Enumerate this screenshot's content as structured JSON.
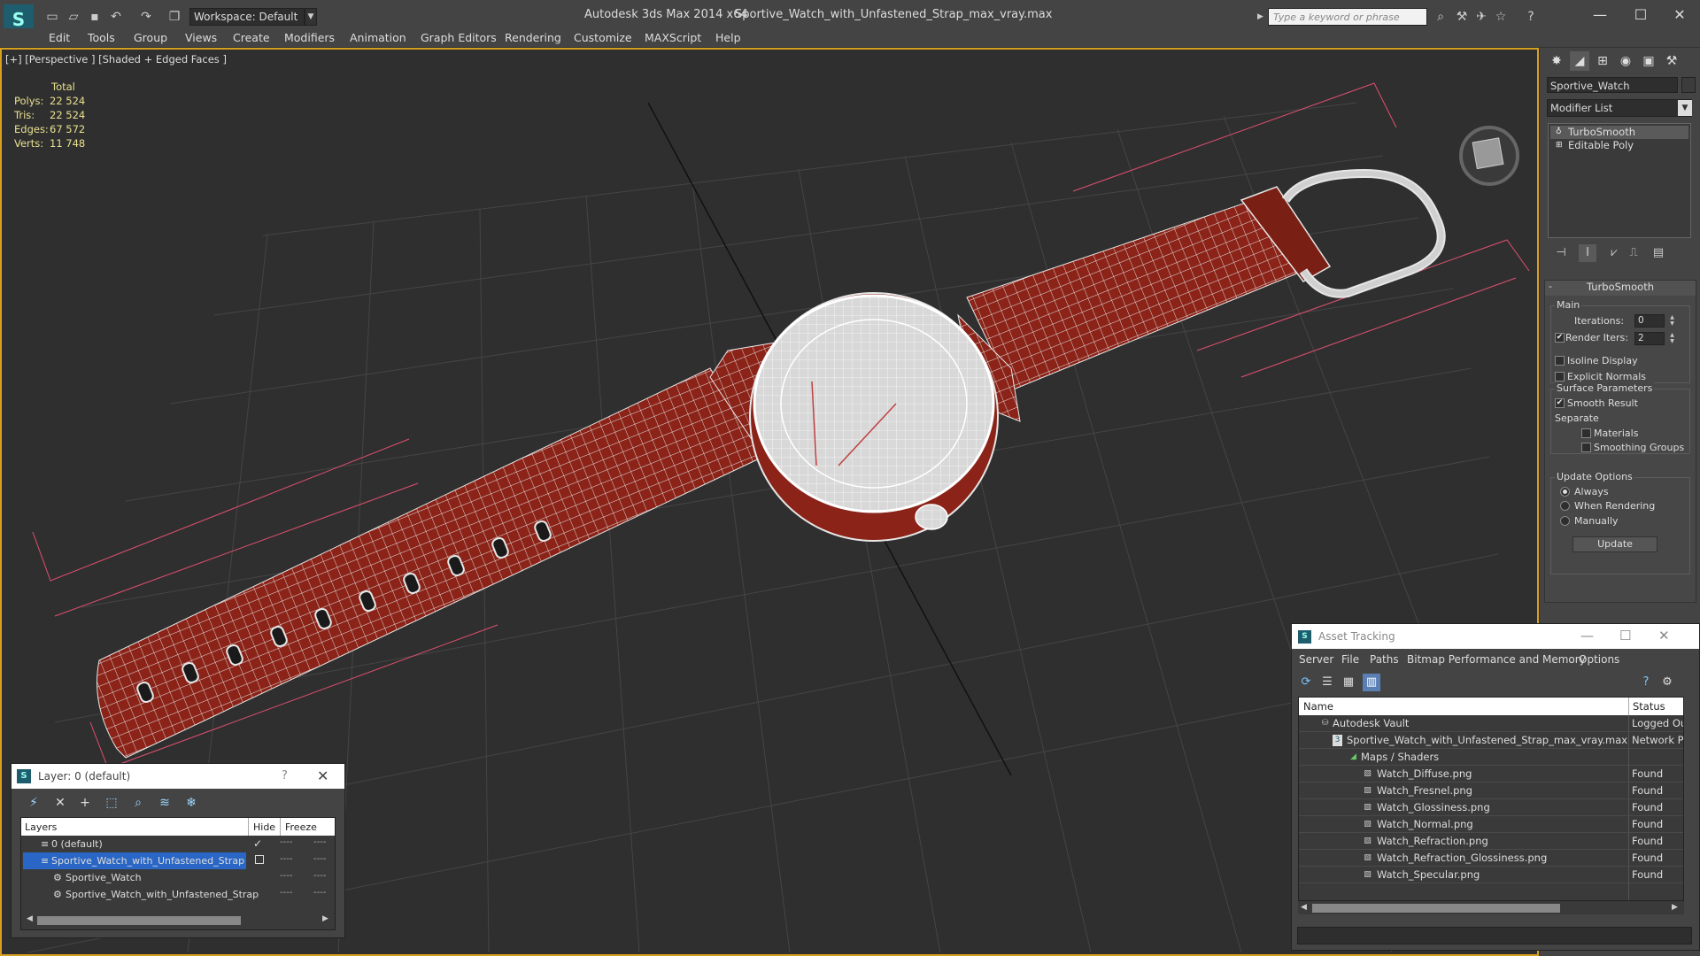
{
  "titlebar": {
    "workspace": "Workspace: Default",
    "app_title": "Autodesk 3ds Max  2014 x64",
    "file_title": "Sportive_Watch_with_Unfastened_Strap_max_vray.max",
    "search_placeholder": "Type a keyword or phrase"
  },
  "menu": [
    "Edit",
    "Tools",
    "Group",
    "Views",
    "Create",
    "Modifiers",
    "Animation",
    "Graph Editors",
    "Rendering",
    "Customize",
    "MAXScript",
    "Help"
  ],
  "viewport": {
    "label": "[+] [Perspective ] [Shaded + Edged Faces ]",
    "stats": {
      "total_label": "Total",
      "rows": [
        {
          "k": "Polys:",
          "v": "22 524"
        },
        {
          "k": "Tris:",
          "v": "22 524"
        },
        {
          "k": "Edges:",
          "v": "67 572"
        },
        {
          "k": "Verts:",
          "v": "11 748"
        }
      ]
    }
  },
  "command_panel": {
    "object_name": "Sportive_Watch",
    "modifier_list": "Modifier List",
    "stack": [
      "TurboSmooth",
      "Editable Poly"
    ],
    "rollout_title": "TurboSmooth",
    "main_group": "Main",
    "iterations_label": "Iterations:",
    "iterations_value": "0",
    "render_iters_label": "Render Iters:",
    "render_iters_value": "2",
    "isoline_label": "Isoline Display",
    "explicit_normals_label": "Explicit Normals",
    "surface_group": "Surface Parameters",
    "smooth_result_label": "Smooth Result",
    "separate_label": "Separate",
    "materials_label": "Materials",
    "smoothing_groups_label": "Smoothing Groups",
    "update_group": "Update Options",
    "always_label": "Always",
    "when_rendering_label": "When Rendering",
    "manually_label": "Manually",
    "update_button": "Update"
  },
  "layer_dialog": {
    "title": "Layer: 0 (default)",
    "help": "?",
    "col_layers": "Layers",
    "col_hide": "Hide",
    "col_freeze": "Freeze",
    "rows": [
      {
        "name": "0 (default)",
        "hide": "----",
        "freeze": "----"
      },
      {
        "name": "Sportive_Watch_with_Unfastened_Strap",
        "hide": "----",
        "freeze": "----"
      },
      {
        "name": "Sportive_Watch",
        "hide": "----",
        "freeze": "----"
      },
      {
        "name": "Sportive_Watch_with_Unfastened_Strap",
        "hide": "----",
        "freeze": "----"
      }
    ]
  },
  "asset_dialog": {
    "title": "Asset Tracking",
    "menu": [
      "Server",
      "File",
      "Paths",
      "Bitmap Performance and Memory",
      "Options"
    ],
    "col_name": "Name",
    "col_status": "Status",
    "rows": [
      {
        "name": "Autodesk Vault",
        "status": "Logged Out"
      },
      {
        "name": "Sportive_Watch_with_Unfastened_Strap_max_vray.max",
        "status": "Network Path"
      },
      {
        "name": "Maps / Shaders",
        "status": ""
      },
      {
        "name": "Watch_Diffuse.png",
        "status": "Found"
      },
      {
        "name": "Watch_Fresnel.png",
        "status": "Found"
      },
      {
        "name": "Watch_Glossiness.png",
        "status": "Found"
      },
      {
        "name": "Watch_Normal.png",
        "status": "Found"
      },
      {
        "name": "Watch_Refraction.png",
        "status": "Found"
      },
      {
        "name": "Watch_Refraction_Glossiness.png",
        "status": "Found"
      },
      {
        "name": "Watch_Specular.png",
        "status": "Found"
      }
    ]
  },
  "colors": {
    "strap": "#8b2318",
    "wire": "#e6e6e6",
    "selection": "#2a66c5",
    "viewport_border": "#d8a020"
  }
}
